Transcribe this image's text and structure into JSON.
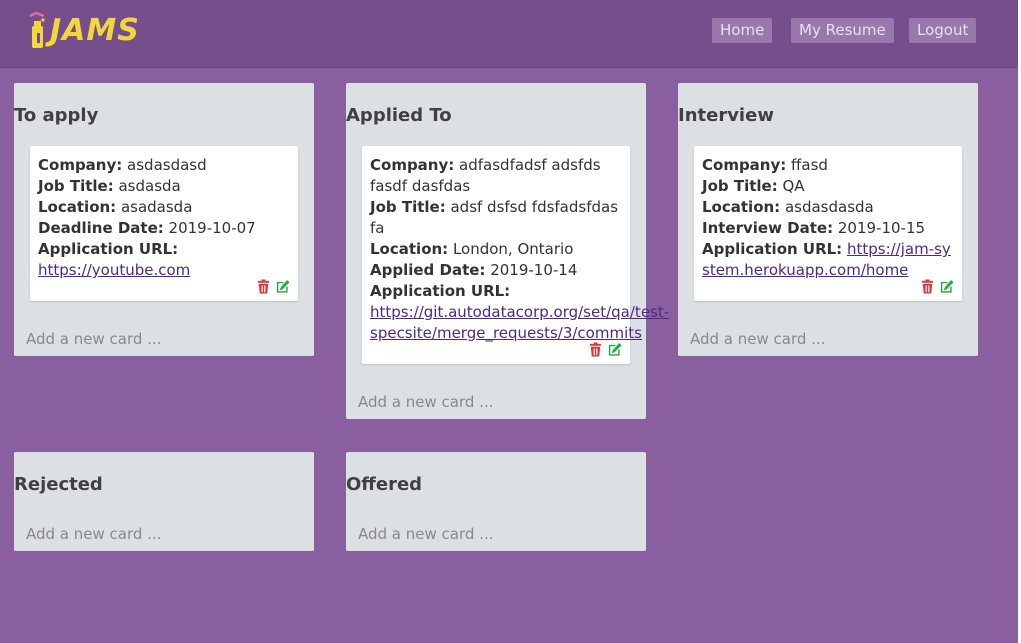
{
  "app": {
    "logo_text": "JAMS"
  },
  "nav": {
    "home": "Home",
    "resume": "My Resume",
    "logout": "Logout"
  },
  "labels": {
    "company": "Company:",
    "job_title": "Job Title:",
    "location": "Location:",
    "deadline": "Deadline Date:",
    "applied_date": "Applied Date:",
    "interview_date": "Interview Date:",
    "app_url": "Application URL:",
    "add_card": "Add a new card ..."
  },
  "columns": {
    "to_apply": {
      "title": "To apply",
      "card": {
        "company": "asdasdasd",
        "job_title": "asdasda",
        "location": "asadasda",
        "deadline": "2019-10-07",
        "url": "https://youtube.com"
      }
    },
    "applied": {
      "title": "Applied To",
      "card": {
        "company": "adfasdfadsf adsfds fasdf dasfdas",
        "job_title": "adsf dsfsd fdsfadsfdas fa",
        "location": "London, Ontario",
        "applied_date": "2019-10-14",
        "url": "https://git.autodatacorp.org/set/qa/test-specsite/merge_requests/3/commits"
      }
    },
    "interview": {
      "title": "Interview",
      "card": {
        "company": "ffasd",
        "job_title": "QA",
        "location": "asdasdasda",
        "interview_date": "2019-10-15",
        "url": "https://jam-system.herokuapp.com/home"
      }
    },
    "rejected": {
      "title": "Rejected"
    },
    "offered": {
      "title": "Offered"
    }
  },
  "colors": {
    "background": "#8a5fa0",
    "navbar": "#764e8c",
    "logo": "#f1d739",
    "delete": "#d9373b",
    "edit": "#22a845"
  }
}
